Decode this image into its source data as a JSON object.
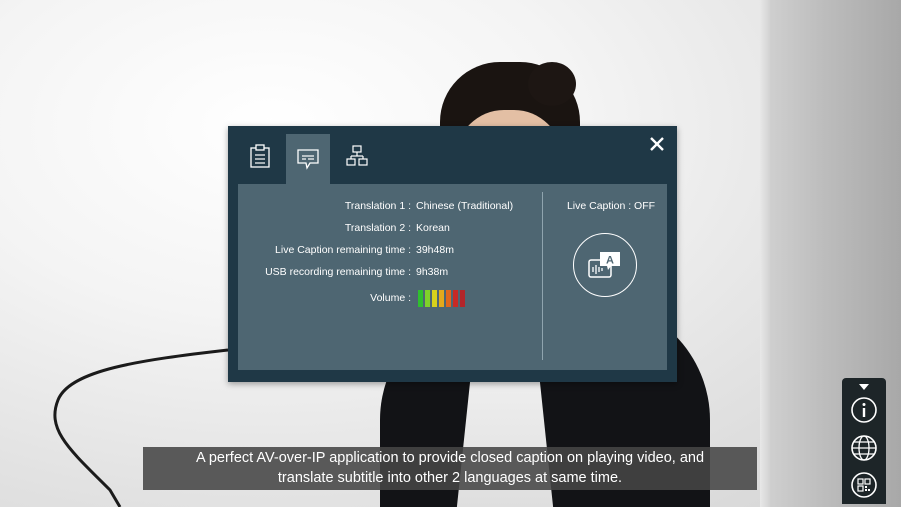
{
  "dialog": {
    "tabs": [
      {
        "icon": "clipboard-icon",
        "active": false
      },
      {
        "icon": "caption-bubble-icon",
        "active": true
      },
      {
        "icon": "network-icon",
        "active": false
      }
    ],
    "close_icon": "close-icon",
    "info": {
      "translation1": {
        "label": "Translation 1 :",
        "value": "Chinese (Traditional)"
      },
      "translation2": {
        "label": "Translation 2 :",
        "value": "Korean"
      },
      "live_caption_time": {
        "label": "Live Caption remaining time :",
        "value": "39h48m"
      },
      "usb_recording_time": {
        "label": "USB recording remaining time :",
        "value": "9h38m"
      },
      "volume": {
        "label": "Volume :",
        "bars": [
          "#2fbf2f",
          "#7fd12a",
          "#d8d21c",
          "#e4a91c",
          "#e1671c",
          "#c72a25",
          "#b3252a"
        ]
      }
    },
    "live_caption": {
      "status": "Live Caption : OFF",
      "icon": "live-caption-toggle-icon"
    }
  },
  "subtitle": {
    "line1": "A perfect AV-over-IP application to provide closed caption on playing video, and",
    "line2": "translate subtitle into other 2 languages at same time."
  },
  "toolbar": {
    "items": [
      "caret-down-icon",
      "info-icon",
      "globe-icon",
      "qr-code-icon"
    ]
  },
  "colors": {
    "dialog_dark": "#1f3846",
    "panel": "#4e6672",
    "toolbar": "#1d2528"
  }
}
